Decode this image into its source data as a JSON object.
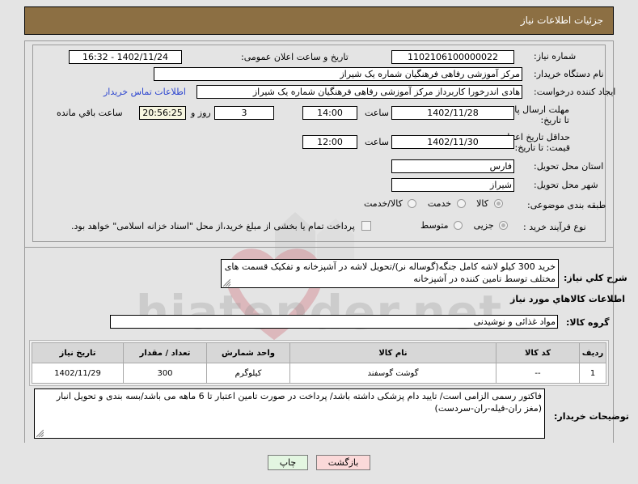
{
  "header": {
    "title": "جزئیات اطلاعات نیاز",
    "bg_color": "#8c6f43"
  },
  "watermark": {
    "text": "hiatender.net"
  },
  "fields": {
    "need_number_label": "شماره نیاز:",
    "need_number_value": "1102106100000022",
    "public_announce_label": "تاریخ و ساعت اعلان عمومی:",
    "public_announce_value": "1402/11/24 - 16:32",
    "buyer_org_label": "نام دستگاه خریدار:",
    "buyer_org_value": "مرکز آموزشی رفاهی فرهنگیان شماره یک شیراز",
    "creator_label": "ایجاد کننده درخواست:",
    "creator_value": "هادی اندرخورا کاربرداز مرکز آموزشی رفاهی فرهنگیان شماره یک شیراز",
    "contact_link": "اطلاعات تماس خریدار",
    "deadline_label": "مهلت ارسال پاسخ: تا تاریخ:",
    "deadline_date": "1402/11/28",
    "deadline_hour_label": "ساعت",
    "deadline_hour": "14:00",
    "days_remaining": "3",
    "days_label": "روز و",
    "time_remaining": "20:56:25",
    "time_remaining_label": "ساعت باقي مانده",
    "price_validity_label": "حداقل تاریخ اعتبار قیمت: تا تاریخ:",
    "price_validity_date": "1402/11/30",
    "price_validity_hour_label": "ساعت",
    "price_validity_hour": "12:00",
    "province_label": "استان محل تحویل:",
    "province_value": "فارس",
    "city_label": "شهر محل تحویل:",
    "city_value": "شیراز",
    "category_label": "طبقه بندی موضوعی:",
    "category_options": [
      {
        "label": "کالا",
        "checked": true
      },
      {
        "label": "خدمت",
        "checked": false
      },
      {
        "label": "کالا/خدمت",
        "checked": false
      }
    ],
    "process_label": "نوع فرآیند خرید :",
    "process_options": [
      {
        "label": "جزیی",
        "checked": true
      },
      {
        "label": "متوسط",
        "checked": false
      }
    ],
    "treasury_checkbox_label": "پرداخت تمام یا بخشی از مبلغ خرید،از محل \"اسناد خزانه اسلامی\" خواهد بود.",
    "treasury_checked": false
  },
  "summary": {
    "label": "شرح کلي نياز:",
    "value": "خرید 300 کیلو لاشه کامل جنگه(گوساله نر)/تحویل لاشه در آشپزخانه و تفکیک قسمت های مختلف توسط تامین کننده در آشپزخانه"
  },
  "goods_section": {
    "title": "اطلاعات کالاهاي مورد نياز",
    "group_label": "گروه کالا:",
    "group_value": "مواد غذائی و نوشیدنی"
  },
  "table": {
    "columns": [
      "ردیف",
      "کد کالا",
      "نام کالا",
      "واحد شمارش",
      "تعداد / مقدار",
      "تاریخ نیاز"
    ],
    "rows": [
      [
        "1",
        "--",
        "گوشت گوسفند",
        "کیلوگرم",
        "300",
        "1402/11/29"
      ]
    ]
  },
  "buyer_notes": {
    "label": "توضیحات خریدار:",
    "value": "فاکتور رسمی الزامی است/ تایید دام پزشکی داشته باشد/ پرداخت در صورت تامین اعتبار تا  6 ماهه می باشد/بسه بندی و تحویل انبار (مغز ران-فیله-ران-سردست)"
  },
  "buttons": {
    "print": "چاپ",
    "back": "بازگشت"
  }
}
